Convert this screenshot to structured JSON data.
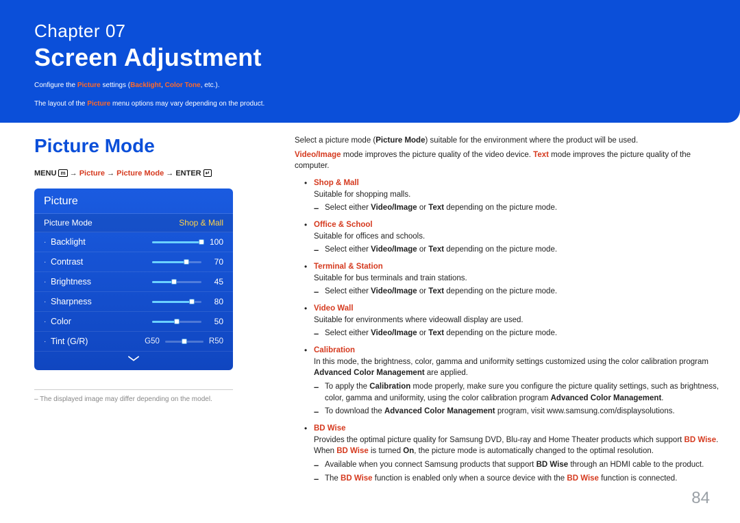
{
  "banner": {
    "chapter_word": "Chapter",
    "chapter_num": "07",
    "title": "Screen Adjustment",
    "sub1_a": "Configure the ",
    "sub1_b": "Picture",
    "sub1_c": " settings (",
    "sub1_d": "Backlight",
    "sub1_e": ", ",
    "sub1_f": "Color Tone",
    "sub1_g": ", etc.).",
    "sub2_a": "The layout of the ",
    "sub2_b": "Picture",
    "sub2_c": " menu options may vary depending on the product."
  },
  "left": {
    "section_title": "Picture Mode",
    "nav": {
      "menu": "MENU",
      "menu_icon": "m",
      "arrow": "→",
      "p1": "Picture",
      "p2": "Picture Mode",
      "enter": "ENTER",
      "enter_icon": "↵"
    },
    "osd": {
      "header": "Picture",
      "mode_label": "Picture Mode",
      "mode_value": "Shop & Mall",
      "rows": [
        {
          "label": "Backlight",
          "value": "100",
          "pct": 100
        },
        {
          "label": "Contrast",
          "value": "70",
          "pct": 70
        },
        {
          "label": "Brightness",
          "value": "45",
          "pct": 45
        },
        {
          "label": "Sharpness",
          "value": "80",
          "pct": 80
        },
        {
          "label": "Color",
          "value": "50",
          "pct": 50
        }
      ],
      "tint": {
        "label": "Tint (G/R)",
        "left": "G50",
        "right": "R50"
      }
    },
    "footnote": "The displayed image may differ depending on the model."
  },
  "right": {
    "intro1_a": "Select a picture mode (",
    "intro1_b": "Picture Mode",
    "intro1_c": ") suitable for the environment where the product will be used.",
    "intro2_a": "Video/Image",
    "intro2_b": " mode improves the picture quality of the video device. ",
    "intro2_c": "Text",
    "intro2_d": " mode improves the picture quality of the computer.",
    "items": {
      "shop": {
        "title": "Shop & Mall",
        "desc": "Suitable for shopping malls.",
        "sub_a": "Select either ",
        "sub_b": "Video/Image",
        "sub_c": " or ",
        "sub_d": "Text",
        "sub_e": " depending on the picture mode."
      },
      "office": {
        "title": "Office & School",
        "desc": "Suitable for offices and schools.",
        "sub_a": "Select either ",
        "sub_b": "Video/Image",
        "sub_c": " or ",
        "sub_d": "Text",
        "sub_e": " depending on the picture mode."
      },
      "terminal": {
        "title": "Terminal & Station",
        "desc": "Suitable for bus terminals and train stations.",
        "sub_a": "Select either ",
        "sub_b": "Video/Image",
        "sub_c": " or ",
        "sub_d": "Text",
        "sub_e": " depending on the picture mode."
      },
      "videowall": {
        "title": "Video Wall",
        "desc": "Suitable for environments where videowall display are used.",
        "sub_a": "Select either ",
        "sub_b": "Video/Image",
        "sub_c": " or ",
        "sub_d": "Text",
        "sub_e": " depending on the picture mode."
      },
      "calibration": {
        "title": "Calibration",
        "desc_a": "In this mode, the brightness, color, gamma and uniformity settings customized using the color calibration program ",
        "desc_b": "Advanced Color Management",
        "desc_c": " are applied.",
        "sub1_a": "To apply the ",
        "sub1_b": "Calibration",
        "sub1_c": " mode properly, make sure you configure the picture quality settings, such as brightness, color, gamma and uniformity, using the color calibration program ",
        "sub1_d": "Advanced Color Management",
        "sub1_e": ".",
        "sub2_a": "To download the ",
        "sub2_b": "Advanced Color Management",
        "sub2_c": " program, visit www.samsung.com/displaysolutions."
      },
      "bdwise": {
        "title": "BD Wise",
        "desc_a": "Provides the optimal picture quality for Samsung DVD, Blu-ray and Home Theater products which support ",
        "desc_b": "BD Wise",
        "desc_c": ". When ",
        "desc_d": "BD Wise",
        "desc_e": " is turned ",
        "desc_f": "On",
        "desc_g": ", the picture mode is automatically changed to the optimal resolution.",
        "sub1_a": "Available when you connect Samsung products that support ",
        "sub1_b": "BD Wise",
        "sub1_c": " through an HDMI cable to the product.",
        "sub2_a": "The ",
        "sub2_b": "BD Wise",
        "sub2_c": " function is enabled only when a source device with the ",
        "sub2_d": "BD Wise",
        "sub2_e": " function is connected."
      }
    }
  },
  "page_number": "84"
}
